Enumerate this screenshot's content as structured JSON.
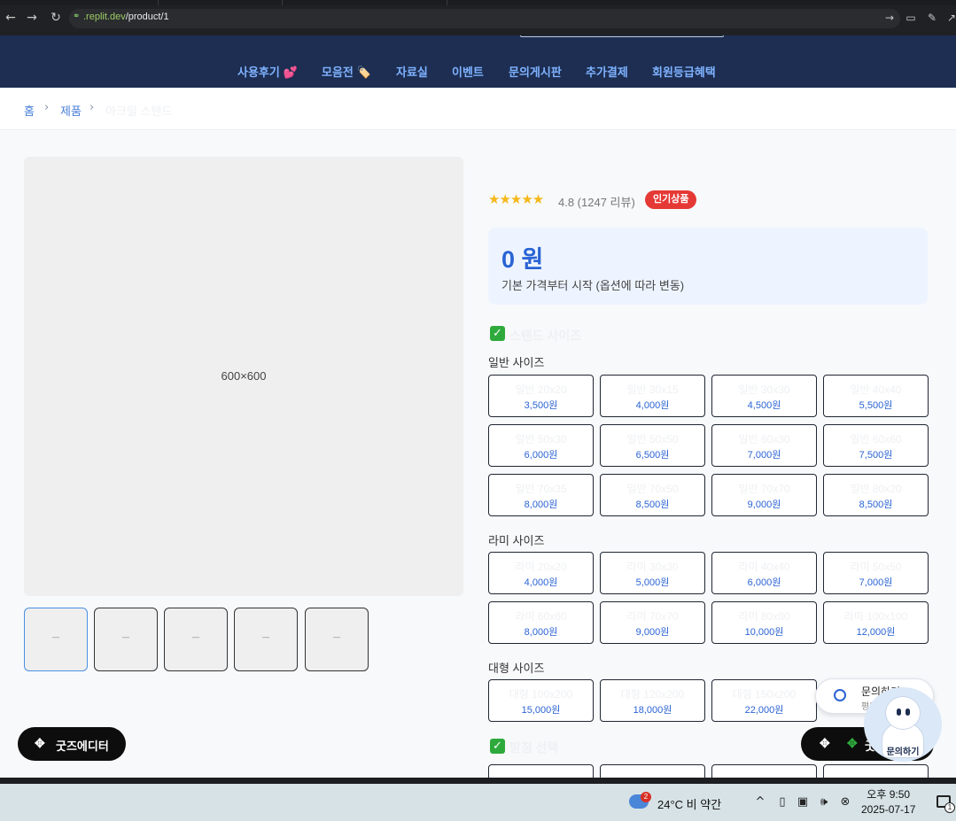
{
  "browser": {
    "url_host": ".replit.dev",
    "url_path": "/product/1"
  },
  "nav": {
    "items": [
      "사용후기 💕",
      "모음전 🏷️",
      "자료실",
      "이벤트",
      "문의게시판",
      "추가결제",
      "회원등급혜택"
    ]
  },
  "breadcrumb": {
    "home": "홈",
    "products": "제품",
    "current": "아크릴 스탠드"
  },
  "gallery": {
    "main_label": "600×600",
    "thumb_label": "—"
  },
  "product": {
    "stars": "★★★★★",
    "rating_text": "4.8 (1247 리뷰)",
    "badge": "인기상품",
    "price": "0 원",
    "price_note": "기본 가격부터 시작 (옵션에 따라 변동)"
  },
  "options": {
    "section_title": "스탠드 사이즈",
    "groups": [
      {
        "label": "일반 사이즈",
        "items": [
          {
            "name": "일반 20x20",
            "price": "3,500원"
          },
          {
            "name": "일반 30x15",
            "price": "4,000원"
          },
          {
            "name": "일반 30x30",
            "price": "4,500원"
          },
          {
            "name": "일반 40x40",
            "price": "5,500원"
          },
          {
            "name": "일반 50x30",
            "price": "6,000원"
          },
          {
            "name": "일반 50x50",
            "price": "6,500원"
          },
          {
            "name": "일반 60x30",
            "price": "7,000원"
          },
          {
            "name": "일반 60x60",
            "price": "7,500원"
          },
          {
            "name": "일반 70x35",
            "price": "8,000원"
          },
          {
            "name": "일반 70x50",
            "price": "8,500원"
          },
          {
            "name": "일반 70x70",
            "price": "9,000원"
          },
          {
            "name": "일반 80x20",
            "price": "8,500원"
          }
        ]
      },
      {
        "label": "라미 사이즈",
        "items": [
          {
            "name": "라미 20x20",
            "price": "4,000원"
          },
          {
            "name": "라미 30x30",
            "price": "5,000원"
          },
          {
            "name": "라미 40x40",
            "price": "6,000원"
          },
          {
            "name": "라미 50x50",
            "price": "7,000원"
          },
          {
            "name": "라미 60x80",
            "price": "8,000원"
          },
          {
            "name": "라미 70x70",
            "price": "9,000원"
          },
          {
            "name": "라미 80x80",
            "price": "10,000원"
          },
          {
            "name": "라미 100x100",
            "price": "12,000원"
          }
        ]
      },
      {
        "label": "대형 사이즈",
        "items": [
          {
            "name": "대형 100x200",
            "price": "15,000원"
          },
          {
            "name": "대형 120x200",
            "price": "18,000원"
          },
          {
            "name": "대형 150x200",
            "price": "22,000원"
          }
        ]
      }
    ],
    "section2_title": "받침 선택"
  },
  "floating": {
    "goods_editor": "굿즈에디터",
    "goods_editor_right": "굿",
    "inquiry_title": "문의하기",
    "inquiry_sub": "평일",
    "mascot_label": "문의하기"
  },
  "taskbar": {
    "weather_badge": "2",
    "weather": "24°C  비 약간",
    "time": "오후 9:50",
    "date": "2025-07-17",
    "notif_count": "1"
  }
}
